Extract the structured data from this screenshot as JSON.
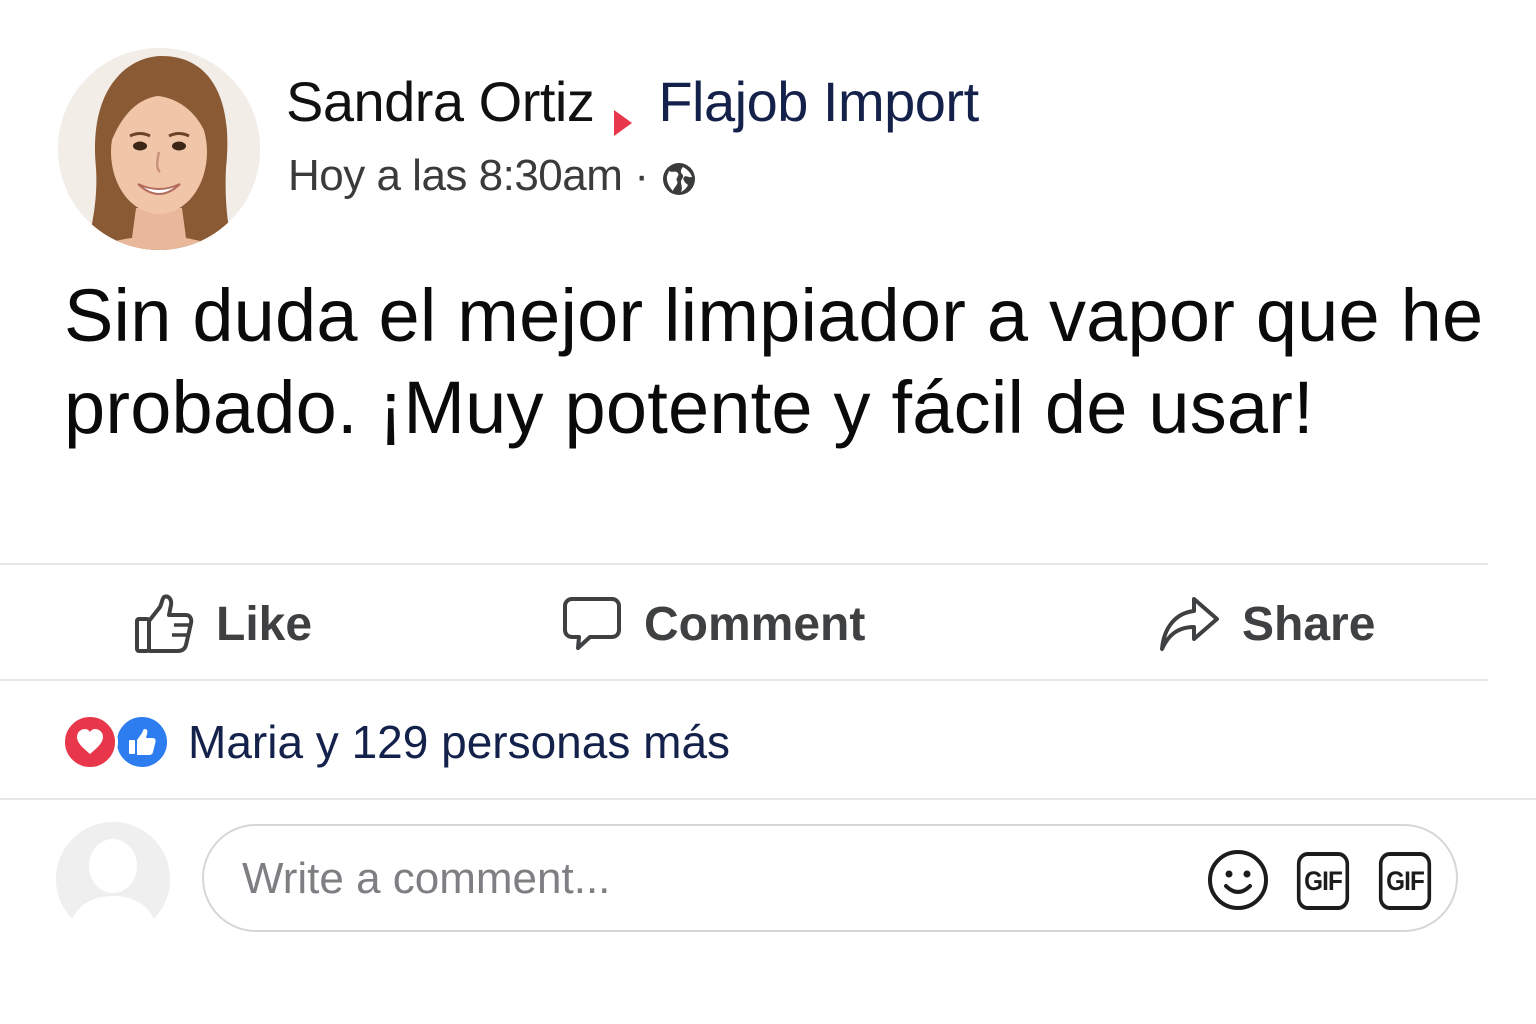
{
  "post": {
    "author": "Sandra Ortiz",
    "page": "Flajob Import",
    "timestamp": "Hoy a las 8:30am",
    "separator": "·",
    "audience_icon": "globe-icon",
    "text": "Sin duda el mejor limpiador a vapor que he probado. ¡Muy potente y fácil de usar!"
  },
  "actions": {
    "like_label": "Like",
    "comment_label": "Comment",
    "share_label": "Share"
  },
  "reactions": {
    "icons": [
      "love-icon",
      "like-icon"
    ],
    "summary": "Maria y 129 personas más"
  },
  "comment_composer": {
    "placeholder": "Write a comment...",
    "emoji_icon": "smiley-icon",
    "gif_label_1": "GIF",
    "gif_label_2": "GIF"
  },
  "colors": {
    "page_name": "#14224b",
    "arrow": "#e8364a",
    "love": "#e8364a",
    "like": "#2d7cf0",
    "divider": "#e6e7e9"
  }
}
